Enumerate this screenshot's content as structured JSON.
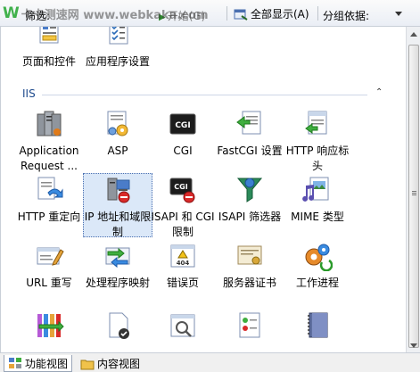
{
  "toolbar": {
    "filter_label": "筛选:",
    "go_label": "开始(G)",
    "show_all_label": "全部显示(A)",
    "group_by_label": "分组依据:"
  },
  "watermark": {
    "logo": "W",
    "text": "卡卡测速网 www.webkaka.com"
  },
  "top_items": [
    {
      "label": "页面和控件",
      "icon": "page-controls-icon"
    },
    {
      "label": "应用程序设置",
      "icon": "app-settings-icon"
    }
  ],
  "section": {
    "title": "IIS",
    "collapse_glyph": "⌃"
  },
  "items": [
    {
      "label": "Application Request ...",
      "icon": "server-farm-icon"
    },
    {
      "label": "ASP",
      "icon": "asp-icon"
    },
    {
      "label": "CGI",
      "icon": "cgi-icon"
    },
    {
      "label": "FastCGI 设置",
      "icon": "fastcgi-icon"
    },
    {
      "label": "HTTP 响应标头",
      "icon": "http-headers-icon"
    },
    {
      "label": "HTTP 重定向",
      "icon": "http-redirect-icon"
    },
    {
      "label": "IP 地址和域限制",
      "icon": "ip-restrictions-icon"
    },
    {
      "label": "ISAPI 和 CGI 限制",
      "icon": "isapi-cgi-icon"
    },
    {
      "label": "ISAPI 筛选器",
      "icon": "isapi-filters-icon"
    },
    {
      "label": "MIME 类型",
      "icon": "mime-types-icon"
    },
    {
      "label": "URL 重写",
      "icon": "url-rewrite-icon"
    },
    {
      "label": "处理程序映射",
      "icon": "handler-mappings-icon"
    },
    {
      "label": "错误页",
      "icon": "error-pages-icon"
    },
    {
      "label": "服务器证书",
      "icon": "server-certificates-icon"
    },
    {
      "label": "工作进程",
      "icon": "worker-processes-icon"
    },
    {
      "label": "",
      "icon": "modules-icon"
    },
    {
      "label": "",
      "icon": "default-document-icon"
    },
    {
      "label": "",
      "icon": "directory-browsing-icon"
    },
    {
      "label": "",
      "icon": "request-filtering-icon"
    },
    {
      "label": "",
      "icon": "logging-icon"
    }
  ],
  "bottom_tabs": [
    {
      "label": "功能视图",
      "icon": "features-view-icon",
      "active": true
    },
    {
      "label": "内容视图",
      "icon": "content-view-icon",
      "active": false
    }
  ],
  "colors": {
    "section_title": "#1e4a8d",
    "selection": "#dbe8f8"
  }
}
